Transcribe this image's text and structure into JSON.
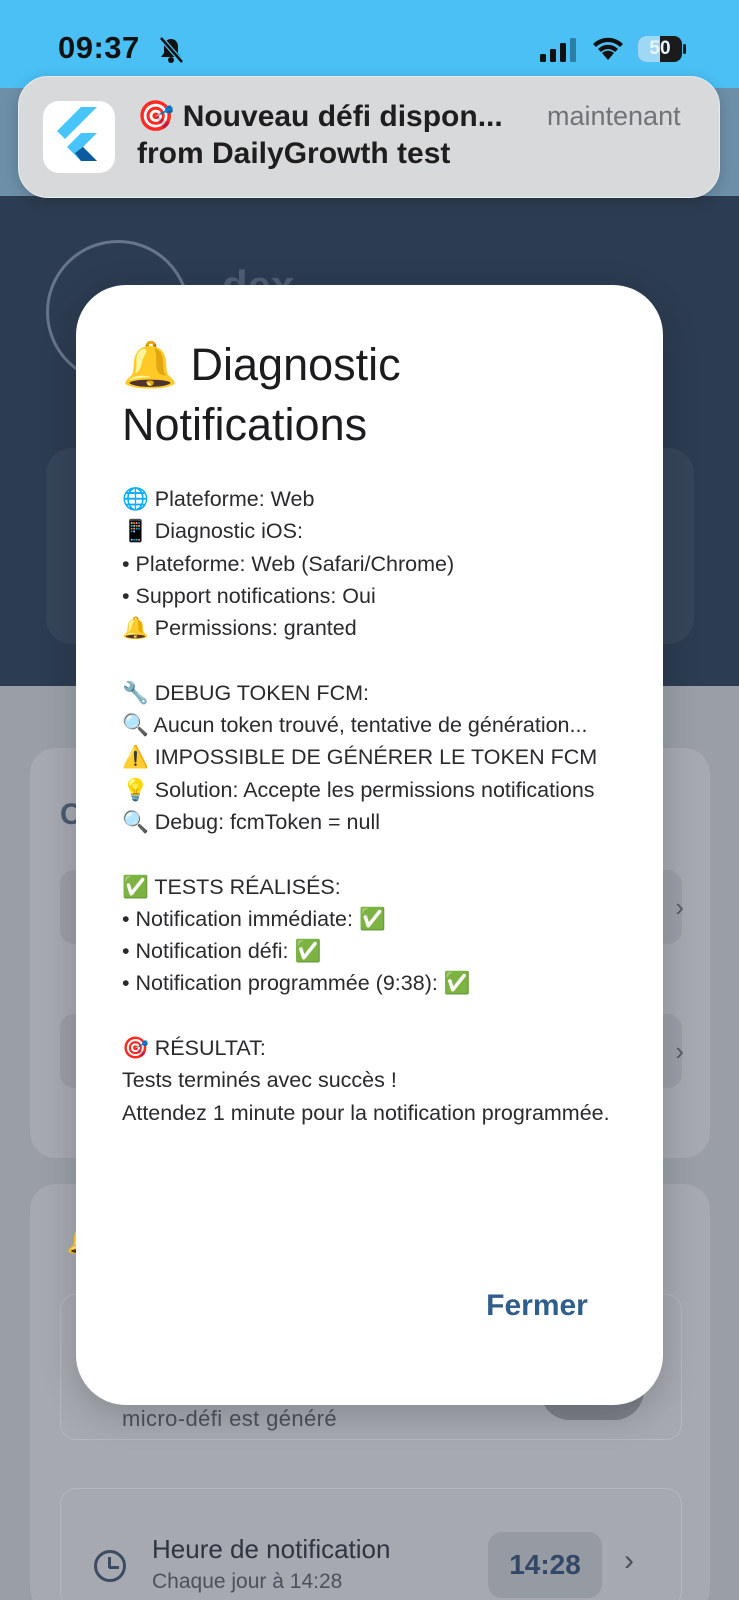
{
  "status_bar": {
    "time": "09:37",
    "battery_level": "50",
    "battery_fraction": 0.5
  },
  "push_notification": {
    "title": "🎯 Nouveau défi dispon...",
    "subtitle": "from DailyGrowth test",
    "time": "maintenant"
  },
  "background": {
    "profile_name": "dex",
    "settings_section_letter": "C",
    "notification_section_letter": "🔔",
    "reminder_subtitle": "micro-défi est généré",
    "notification_time_title": "Heure de notification",
    "notification_time_subtitle": "Chaque jour à 14:28",
    "notification_time_value": "14:28"
  },
  "dialog": {
    "title": "🔔 Diagnostic Notifications",
    "lines": [
      "🌐 Plateforme: Web",
      "📱 Diagnostic iOS:",
      "• Plateforme: Web (Safari/Chrome)",
      "• Support notifications: Oui",
      "🔔 Permissions: granted",
      "",
      "🔧 DEBUG TOKEN FCM:",
      "🔍 Aucun token trouvé, tentative de génération...",
      "⚠️ IMPOSSIBLE DE GÉNÉRER LE TOKEN FCM",
      "💡 Solution: Accepte les permissions notifications",
      "🔍 Debug: fcmToken = null",
      "",
      "✅ TESTS RÉALISÉS:",
      "• Notification immédiate: ✅",
      "• Notification défi: ✅",
      "• Notification programmée (9:38): ✅",
      "",
      "🎯 RÉSULTAT:",
      "Tests terminés avec succès !",
      "Attendez 1 minute pour la notification programmée."
    ],
    "close_label": "Fermer"
  }
}
